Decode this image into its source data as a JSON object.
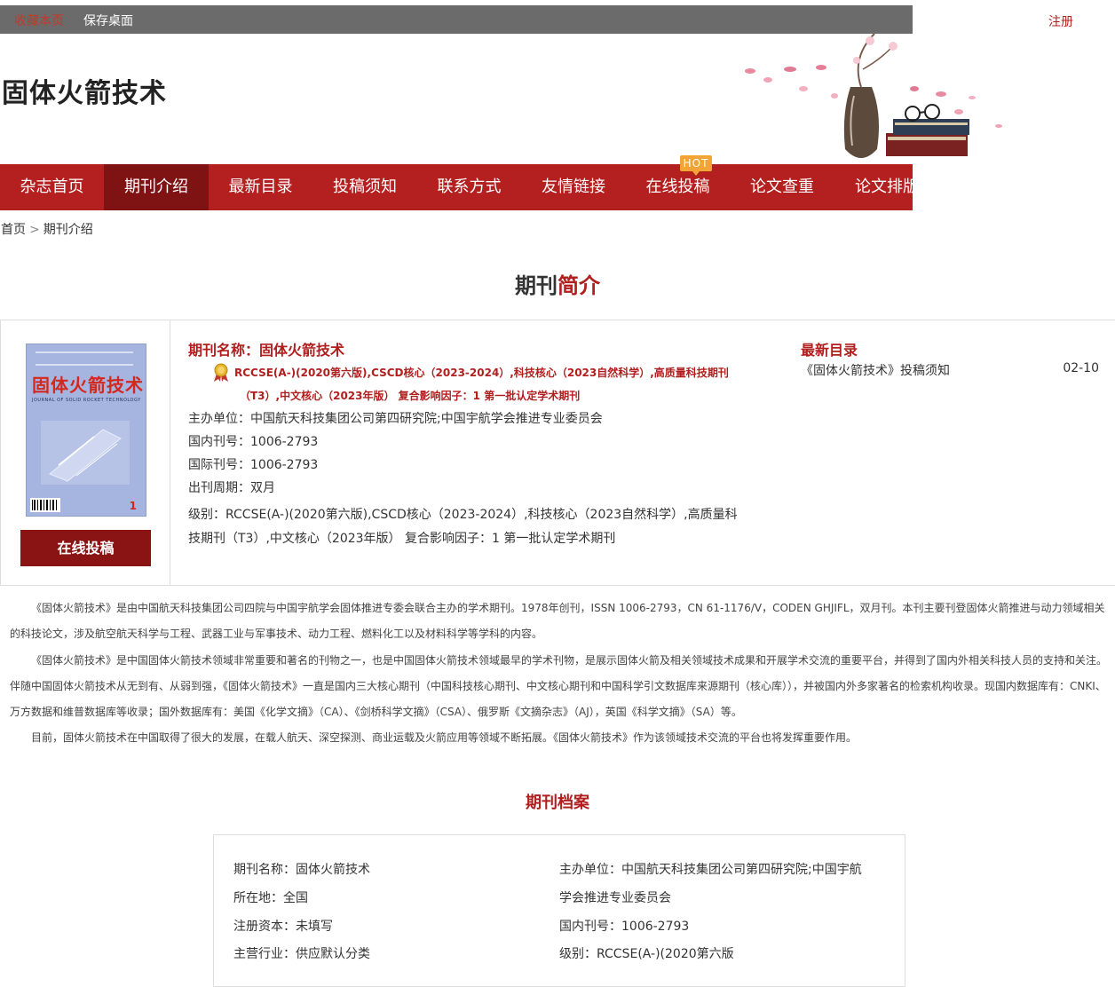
{
  "topbar": {
    "favorite": "收藏本页",
    "save_desktop": "保存桌面",
    "register": "注册"
  },
  "site": {
    "title": "固体火箭技术"
  },
  "nav": {
    "items": [
      "杂志首页",
      "期刊介绍",
      "最新目录",
      "投稿须知",
      "联系方式",
      "友情链接",
      "在线投稿",
      "论文查重",
      "论文排版"
    ],
    "hot_badge": "HOT"
  },
  "breadcrumb": {
    "home": "首页",
    "sep": ">",
    "current": "期刊介绍"
  },
  "intro_heading": {
    "part1": "期刊",
    "part2": "简介"
  },
  "cover": {
    "title": "固体火箭技术",
    "subtitle": "JOURNAL OF SOLID ROCKET TECHNOLOGY",
    "issue": "1"
  },
  "submit_button": "在线投稿",
  "info": {
    "name": "期刊名称：固体火箭技术",
    "badges_line1": "RCCSE(A-)(2020第六版),CSCD核心（2023-2024）,科技核心（2023自然科学）,高质量科技期刊",
    "badges_line2": "（T3）,中文核心（2023年版） 复合影响因子：1 第一批认定学术期刊",
    "sponsor": "主办单位：中国航天科技集团公司第四研究院;中国宇航学会推进专业委员会",
    "cn": "国内刊号：1006-2793",
    "issn": "国际刊号：1006-2793",
    "cycle": "出刊周期：双月",
    "level_line1": "级别：RCCSE(A-)(2020第六版),CSCD核心（2023-2024）,科技核心（2023自然科学）,高质量科",
    "level_line2": "技期刊（T3）,中文核心（2023年版） 复合影响因子：1 第一批认定学术期刊"
  },
  "latest": {
    "title": "最新目录",
    "items": [
      {
        "text": "《固体火箭技术》投稿须知",
        "date": "02-10"
      }
    ]
  },
  "description": [
    "《固体火箭技术》是由中国航天科技集团公司四院与中国宇航学会固体推进专委会联合主办的学术期刊。1978年创刊，ISSN 1006-2793，CN 61-1176/V，CODEN GHJIFL，双月刊。本刊主要刊登固体火箭推进与动力领域相关的科技论文，涉及航空航天科学与工程、武器工业与军事技术、动力工程、燃料化工以及材料科学等学科的内容。",
    "《固体火箭技术》是中国固体火箭技术领域非常重要和著名的刊物之一，也是中国固体火箭技术领域最早的学术刊物，是展示固体火箭及相关领域技术成果和开展学术交流的重要平台，并得到了国内外相关科技人员的支持和关注。伴随中国固体火箭技术从无到有、从弱到强，《固体火箭技术》一直是国内三大核心期刊（中国科技核心期刊、中文核心期刊和中国科学引文数据库来源期刊（核心库）），并被国内外多家著名的检索机构收录。现国内数据库有：CNKI、万方数据和维普数据库等收录；国外数据库有：美国《化学文摘》（CA）、《剑桥科学文摘》（CSA）、俄罗斯《文摘杂志》（AJ），英国《科学文摘》（SA）等。",
    "目前，固体火箭技术在中国取得了很大的发展，在载人航天、深空探测、商业运载及火箭应用等领域不断拓展。《固体火箭技术》作为该领域技术交流的平台也将发挥重要作用。"
  ],
  "archive_heading": {
    "part1": "期刊",
    "part2": "档案"
  },
  "archive": {
    "name": "期刊名称：固体火箭技术",
    "location": "所在地：全国",
    "capital": "注册资本：未填写",
    "industry": "主营行业：供应默认分类",
    "sponsor": "主办单位：中国航天科技集团公司第四研究院;中国宇航",
    "sponsor_cont": "学会推进专业委员会",
    "cn": "国内刊号：1006-2793",
    "level": "级别：RCCSE(A-)(2020第六版"
  }
}
